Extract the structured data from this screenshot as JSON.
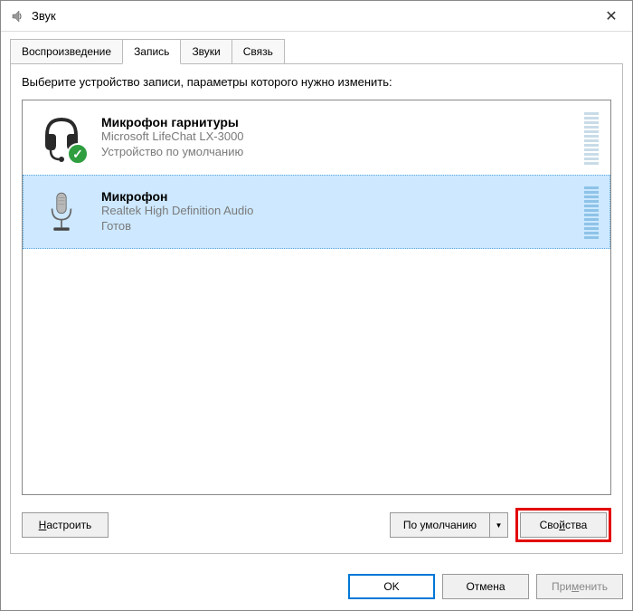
{
  "window": {
    "title": "Звук"
  },
  "tabs": {
    "playback": "Воспроизведение",
    "recording": "Запись",
    "sounds": "Звуки",
    "communications": "Связь"
  },
  "instruction": "Выберите устройство записи, параметры которого нужно изменить:",
  "devices": [
    {
      "name": "Микрофон гарнитуры",
      "driver": "Microsoft LifeChat LX-3000",
      "status": "Устройство по умолчанию"
    },
    {
      "name": "Микрофон",
      "driver": "Realtek High Definition Audio",
      "status": "Готов"
    }
  ],
  "panel_buttons": {
    "configure": "Настроить",
    "set_default": "По умолчанию",
    "properties": "Свойства"
  },
  "dialog_buttons": {
    "ok": "OK",
    "cancel": "Отмена",
    "apply": "Применить"
  }
}
